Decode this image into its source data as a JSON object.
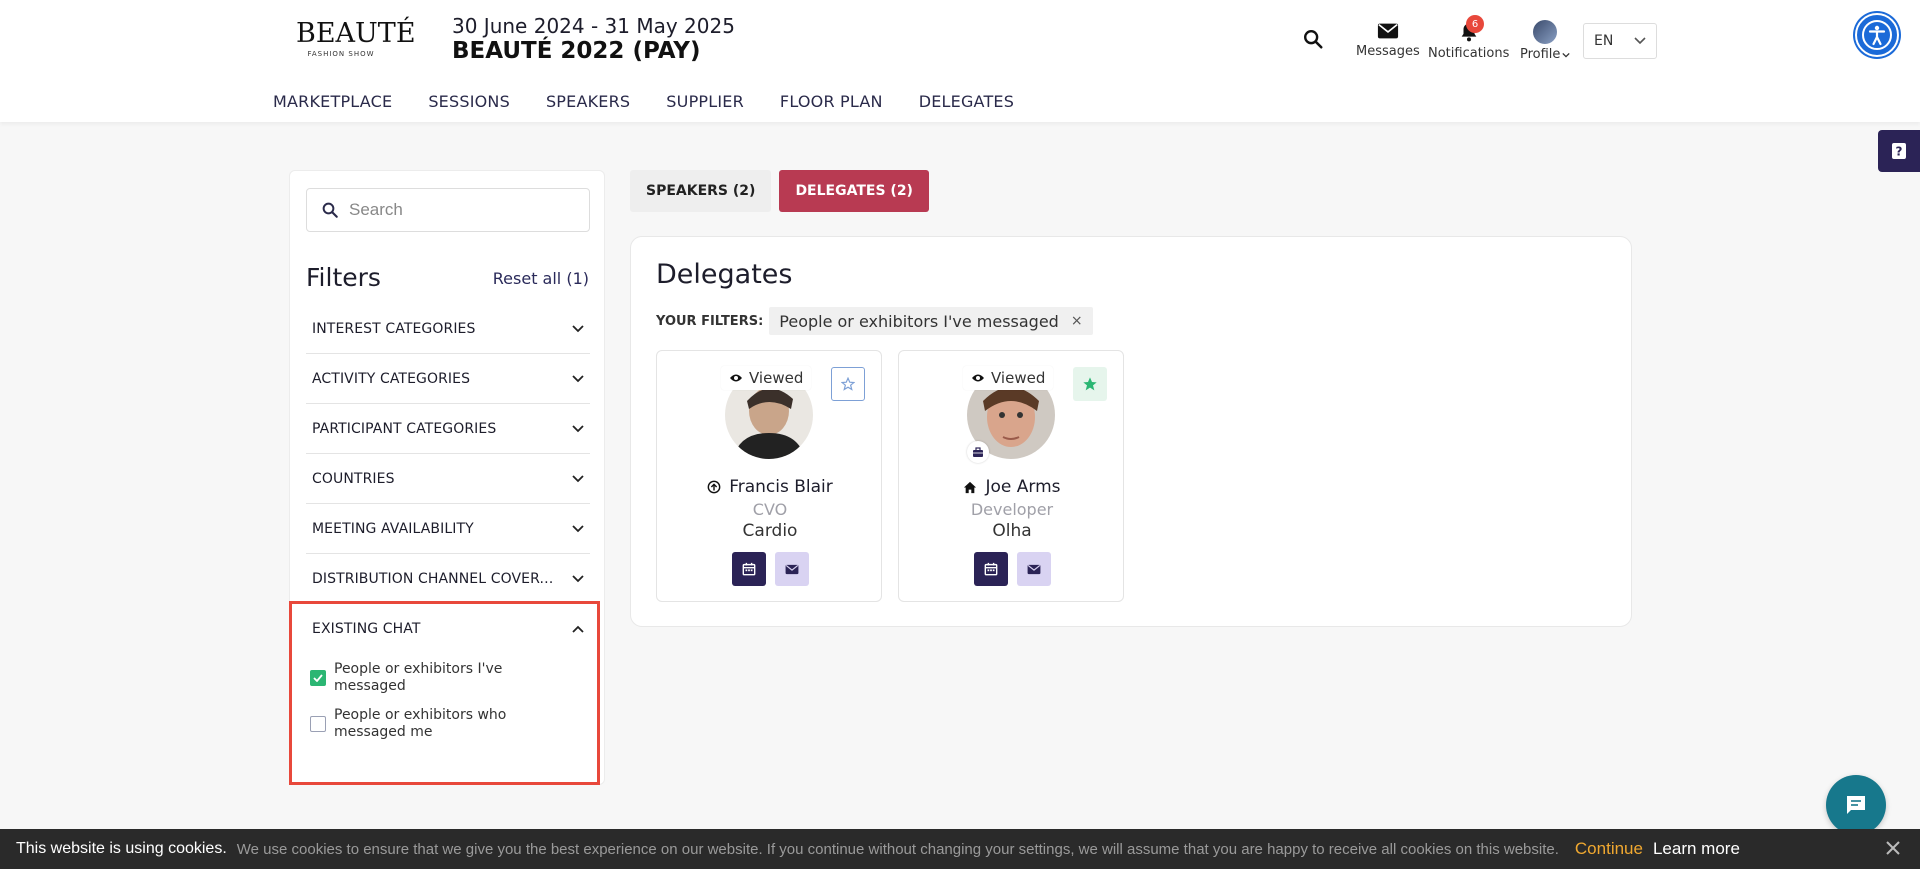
{
  "header": {
    "logo_main": "BEAUTÉ",
    "logo_sub": "FASHION SHOW",
    "event_dates": "30 June 2024 - 31 May 2025",
    "event_title": "BEAUTÉ 2022 (PAY)",
    "messages_label": "Messages",
    "notifications_label": "Notifications",
    "notifications_count": "6",
    "profile_label": "Profile",
    "language": "EN",
    "icons": [
      "search-icon",
      "envelope-icon",
      "bell-icon",
      "avatar",
      "chevron-down-icon",
      "accessibility-icon"
    ]
  },
  "nav": {
    "items": [
      "MARKETPLACE",
      "SESSIONS",
      "SPEAKERS",
      "SUPPLIER",
      "FLOOR PLAN",
      "DELEGATES"
    ]
  },
  "sidebar": {
    "search_placeholder": "Search",
    "filters_title": "Filters",
    "reset_label": "Reset all (1)",
    "filters": [
      {
        "label": "INTEREST CATEGORIES"
      },
      {
        "label": "ACTIVITY CATEGORIES"
      },
      {
        "label": "PARTICIPANT CATEGORIES"
      },
      {
        "label": "COUNTRIES"
      },
      {
        "label": "MEETING AVAILABILITY"
      },
      {
        "label": "DISTRIBUTION CHANNEL COVERAGE"
      }
    ],
    "existing_chat": {
      "label": "EXISTING CHAT",
      "options": [
        {
          "label": "People or exhibitors I've messaged",
          "checked": true
        },
        {
          "label": "People or exhibitors who messaged me",
          "checked": false
        }
      ]
    }
  },
  "tabs": {
    "speakers": "SPEAKERS (2)",
    "delegates": "DELEGATES (2)",
    "active": "delegates"
  },
  "panel": {
    "title": "Delegates",
    "your_filters_label": "YOUR FILTERS:",
    "active_filter_chip": "People or exhibitors I've messaged",
    "chip_close": "×"
  },
  "delegates": [
    {
      "name": "Francis Blair",
      "role": "CVO",
      "company": "Cardio",
      "viewed": "Viewed",
      "favorited": false,
      "name_icon": "arrow-up-circle-icon"
    },
    {
      "name": "Joe Arms",
      "role": "Developer",
      "company": "Olha",
      "viewed": "Viewed",
      "favorited": true,
      "name_icon": "home-icon"
    }
  ],
  "cookie": {
    "strong": "This website is using cookies.",
    "text": "We use cookies to ensure that we give you the best experience on our website. If you continue without changing your settings, we will assume that you are happy to receive all cookies on this website.",
    "continue": "Continue",
    "learn_more": "Learn more"
  },
  "colors": {
    "accent": "#b83a52",
    "dark_purple": "#2b2356",
    "light_purple": "#d9d3f2",
    "checkbox_green": "#2bb673",
    "highlight_red": "#e8483b",
    "chat_teal": "#17788c",
    "continue_orange": "#f0a830"
  }
}
